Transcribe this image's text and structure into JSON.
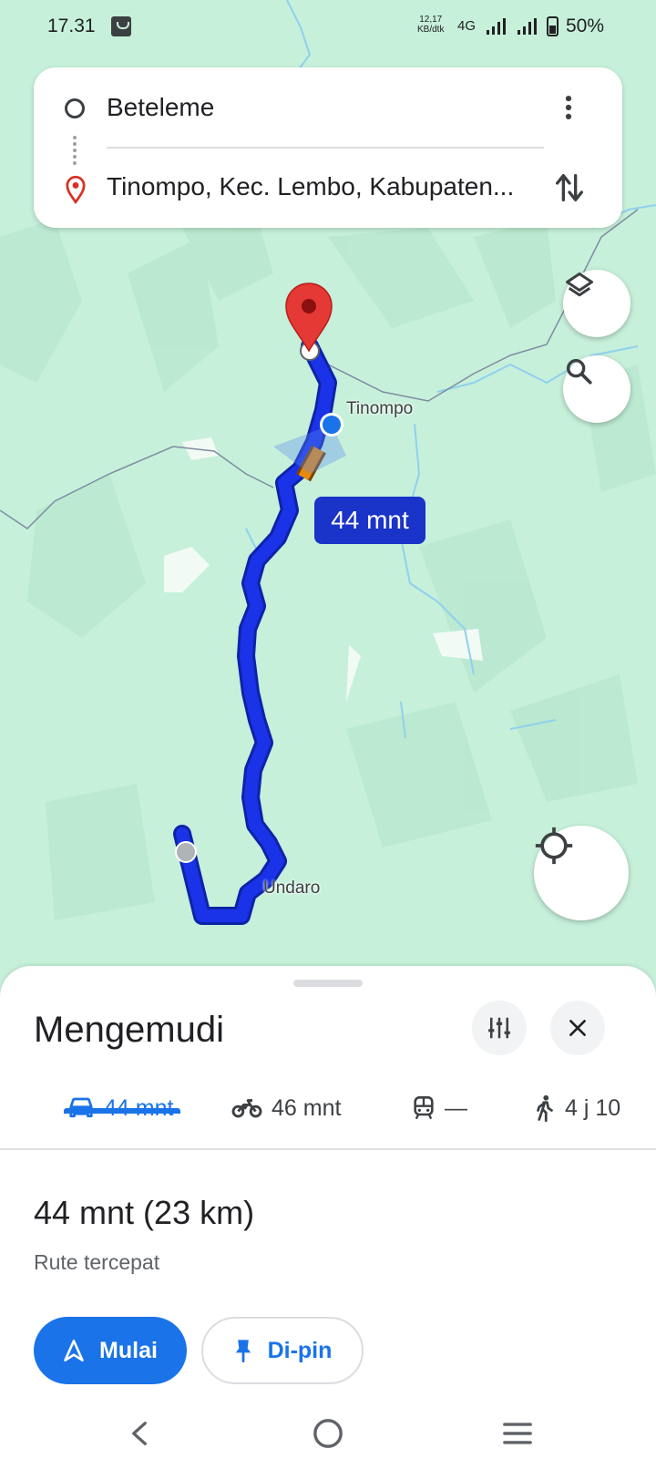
{
  "status_bar": {
    "time": "17.31",
    "speed_value": "12,17",
    "speed_unit": "KB/dtk",
    "network": "4G",
    "battery": "50%"
  },
  "search": {
    "origin": "Beteleme",
    "destination": "Tinompo, Kec. Lembo, Kabupaten..."
  },
  "map": {
    "eta_label": "44 mnt",
    "places": [
      "Tinompo",
      "Undaro"
    ],
    "route_color": "#1a33e8",
    "traffic_color": "#e8890c"
  },
  "sheet": {
    "title": "Mengemudi",
    "modes": [
      {
        "icon": "car-icon",
        "label": "44 mnt",
        "active": true
      },
      {
        "icon": "motorcycle-icon",
        "label": "46 mnt",
        "active": false
      },
      {
        "icon": "transit-icon",
        "label": "—",
        "active": false
      },
      {
        "icon": "walk-icon",
        "label": "4 j 10",
        "active": false
      }
    ],
    "summary": "44 mnt (23 km)",
    "subtitle": "Rute tercepat",
    "start_label": "Mulai",
    "pin_label": "Di-pin"
  },
  "colors": {
    "accent": "#1a73e8",
    "map_bg": "#c6f0da"
  }
}
